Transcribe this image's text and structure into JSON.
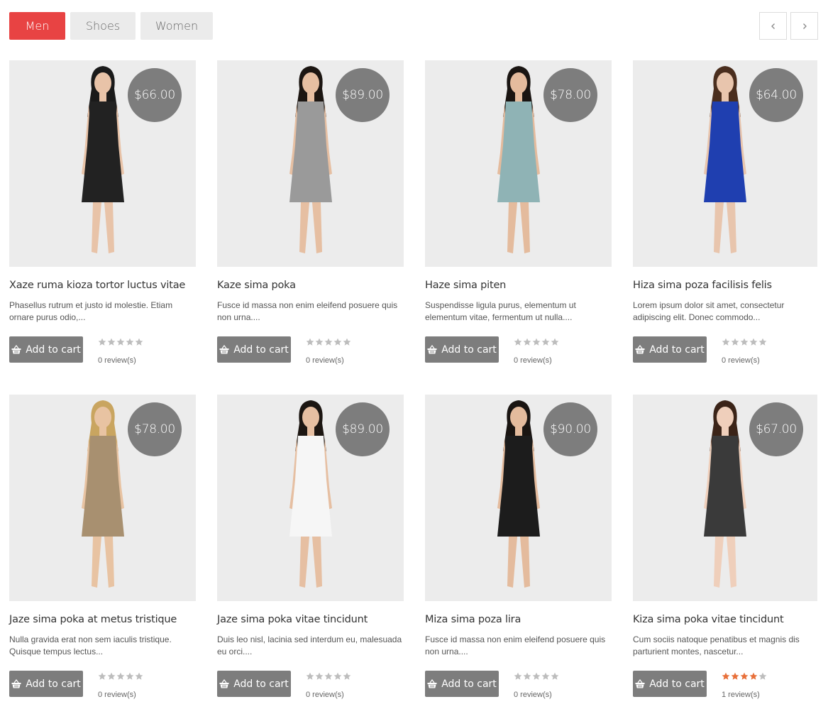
{
  "tabs": [
    {
      "label": "Men",
      "active": true
    },
    {
      "label": "Shoes",
      "active": false
    },
    {
      "label": "Women",
      "active": false
    }
  ],
  "nav": {
    "prev_icon": "chevron-left-icon",
    "next_icon": "chevron-right-icon"
  },
  "colors": {
    "accent": "#e84343",
    "price_bg": "#7d7d7d",
    "star_on": "#e8703a",
    "star_off": "#bdbdbd"
  },
  "products": [
    {
      "price": "$66.00",
      "title": "Xaze ruma kioza tortor luctus vitae",
      "desc": "Phasellus rutrum et justo id molestie. Etiam ornare purus odio,...",
      "cart_label": "Add to cart",
      "rating": 0,
      "reviews": "0 review(s)",
      "outfit": "#222222",
      "skin": "#e8c3a8",
      "hair": "#1a1a1a"
    },
    {
      "price": "$89.00",
      "title": "Kaze sima poka",
      "desc": "Fusce id massa non enim eleifend posuere quis non urna....",
      "cart_label": "Add to cart",
      "rating": 0,
      "reviews": "0 review(s)",
      "outfit": "#9a9a9a",
      "skin": "#e6bfa2",
      "hair": "#1c1612"
    },
    {
      "price": "$78.00",
      "title": "Haze sima piten",
      "desc": "Suspendisse ligula purus, elementum ut elementum vitae, fermentum ut nulla....",
      "cart_label": "Add to cart",
      "rating": 0,
      "reviews": "0 review(s)",
      "outfit": "#8fb3b5",
      "skin": "#e4bb9d",
      "hair": "#1a1512"
    },
    {
      "price": "$64.00",
      "title": "Hiza sima poza facilisis felis",
      "desc": "Lorem ipsum dolor sit amet, consectetur adipiscing elit. Donec commodo...",
      "cart_label": "Add to cart",
      "rating": 0,
      "reviews": "0 review(s)",
      "outfit": "#1f3fb0",
      "skin": "#e8c5ad",
      "hair": "#4a2e1e"
    },
    {
      "price": "$78.00",
      "title": "Jaze sima poka at metus tristique",
      "desc": "Nulla gravida erat non sem iaculis tristique. Quisque tempus lectus...",
      "cart_label": "Add to cart",
      "rating": 0,
      "reviews": "0 review(s)",
      "outfit": "#a89070",
      "skin": "#e8c3a2",
      "hair": "#c9a560"
    },
    {
      "price": "$89.00",
      "title": "Jaze sima poka vitae tincidunt",
      "desc": "Duis leo nisl, lacinia sed interdum eu, malesuada eu orci....",
      "cart_label": "Add to cart",
      "rating": 0,
      "reviews": "0 review(s)",
      "outfit": "#f6f6f6",
      "skin": "#e6bfa2",
      "hair": "#1c1612"
    },
    {
      "price": "$90.00",
      "title": "Miza sima poza lira",
      "desc": "Fusce id massa non enim eleifend posuere quis non urna....",
      "cart_label": "Add to cart",
      "rating": 0,
      "reviews": "0 review(s)",
      "outfit": "#1c1c1c",
      "skin": "#e4bb9d",
      "hair": "#1a1512"
    },
    {
      "price": "$67.00",
      "title": "Kiza sima poka vitae tincidunt",
      "desc": "Cum sociis natoque penatibus et magnis dis parturient montes, nascetur...",
      "cart_label": "Add to cart",
      "rating": 4,
      "reviews": "1 review(s)",
      "outfit": "#3a3a3a",
      "skin": "#efcfbb",
      "hair": "#3b2418"
    }
  ]
}
